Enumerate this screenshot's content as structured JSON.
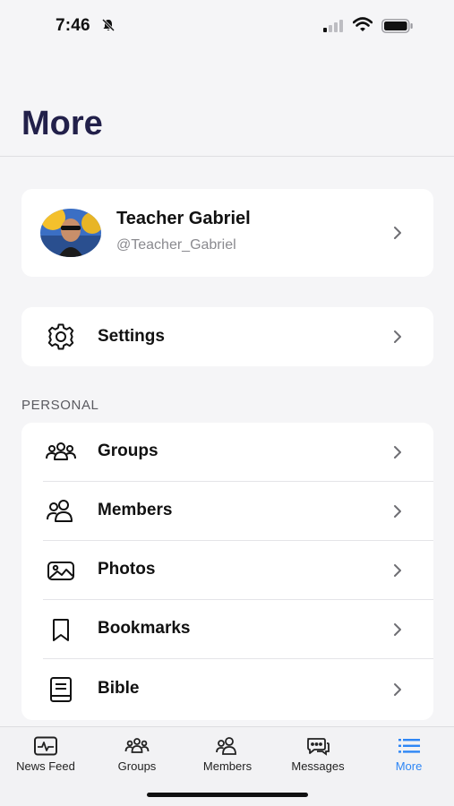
{
  "status_bar": {
    "time": "7:46"
  },
  "page": {
    "title": "More"
  },
  "profile": {
    "name": "Teacher Gabriel",
    "handle": "@Teacher_Gabriel"
  },
  "settings": {
    "label": "Settings",
    "icon": "gear-icon"
  },
  "personal": {
    "section_label": "PERSONAL",
    "items": [
      {
        "label": "Groups",
        "icon": "groups-icon"
      },
      {
        "label": "Members",
        "icon": "members-icon"
      },
      {
        "label": "Photos",
        "icon": "photos-icon"
      },
      {
        "label": "Bookmarks",
        "icon": "bookmark-icon"
      },
      {
        "label": "Bible",
        "icon": "book-icon"
      }
    ]
  },
  "tab_bar": {
    "tabs": [
      {
        "label": "News Feed",
        "icon": "news-feed-icon",
        "active": false
      },
      {
        "label": "Groups",
        "icon": "groups-icon",
        "active": false
      },
      {
        "label": "Members",
        "icon": "members-icon",
        "active": false
      },
      {
        "label": "Messages",
        "icon": "messages-icon",
        "active": false
      },
      {
        "label": "More",
        "icon": "list-icon",
        "active": true
      }
    ]
  },
  "colors": {
    "title": "#22204a",
    "active_tab": "#2e86f5",
    "background": "#f5f5f7"
  }
}
